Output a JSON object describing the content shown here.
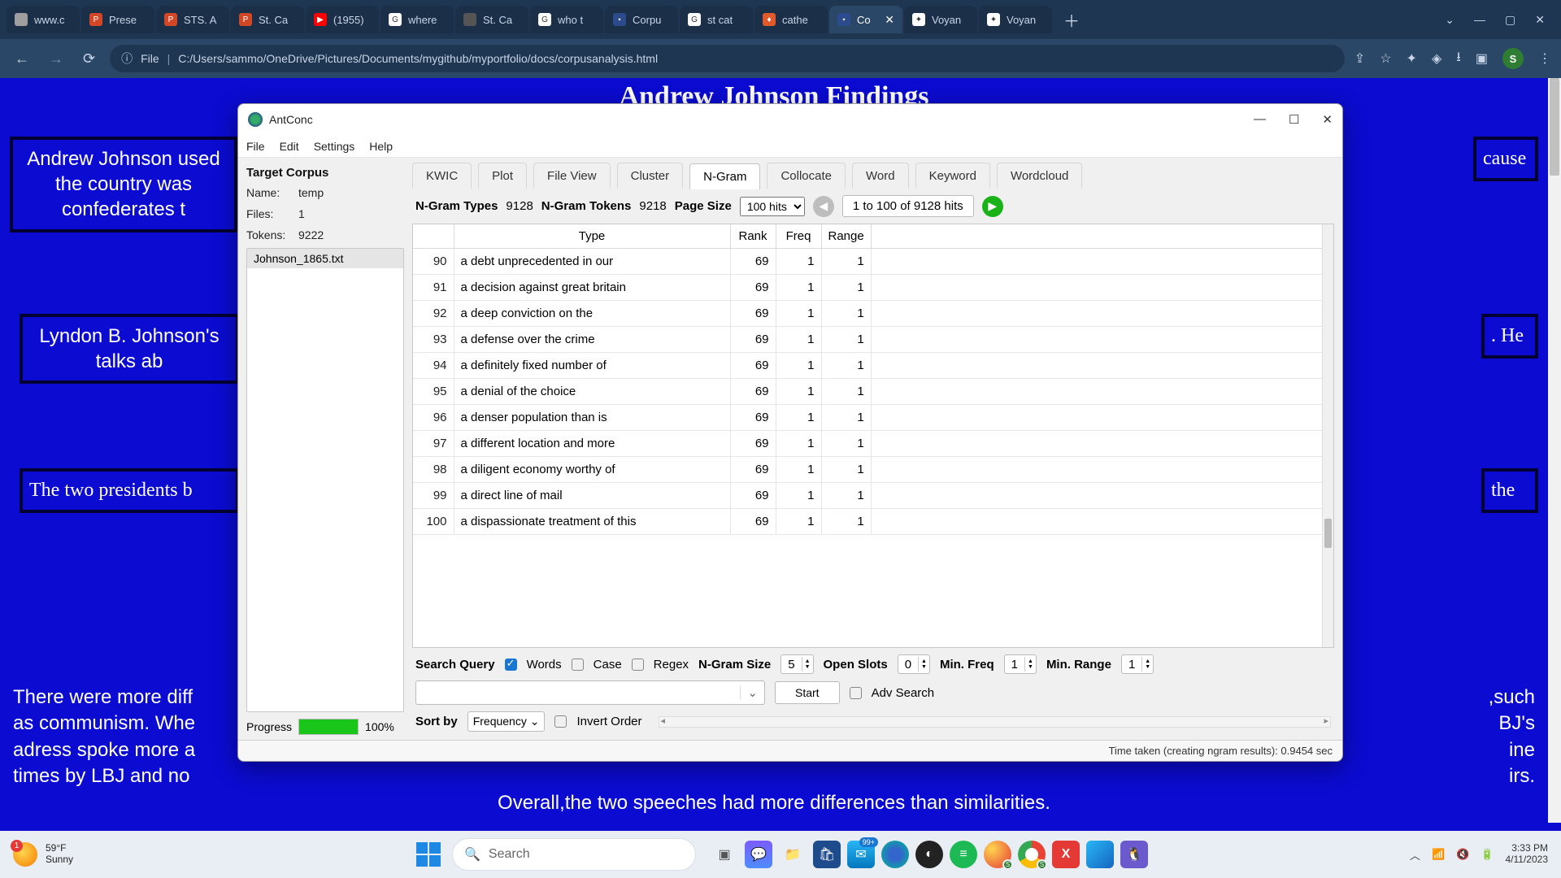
{
  "browser": {
    "tabs": [
      {
        "label": "www.c",
        "fav_bg": "#9e9e9e"
      },
      {
        "label": "Prese",
        "fav_bg": "#d24726",
        "fav_txt": "P"
      },
      {
        "label": "STS. A",
        "fav_bg": "#d24726",
        "fav_txt": "P"
      },
      {
        "label": "St. Ca",
        "fav_bg": "#d24726",
        "fav_txt": "P"
      },
      {
        "label": "(1955)",
        "fav_bg": "#ff0000",
        "fav_txt": "▶"
      },
      {
        "label": "where",
        "fav_bg": "#ffffff",
        "fav_txt": "G"
      },
      {
        "label": "St. Ca",
        "fav_bg": "#555555"
      },
      {
        "label": "who t",
        "fav_bg": "#ffffff",
        "fav_txt": "G"
      },
      {
        "label": "Corpu",
        "fav_bg": "#2b4b8c",
        "fav_txt": "⋆"
      },
      {
        "label": "st cat",
        "fav_bg": "#ffffff",
        "fav_txt": "G"
      },
      {
        "label": "cathe",
        "fav_bg": "#e05a2b",
        "fav_txt": "♦"
      },
      {
        "label": "Co",
        "fav_bg": "#2b4b8c",
        "fav_txt": "⋆",
        "active": true
      },
      {
        "label": "Voyan",
        "fav_bg": "#ffffff",
        "fav_txt": "✦"
      },
      {
        "label": "Voyan",
        "fav_bg": "#ffffff",
        "fav_txt": "✦"
      }
    ],
    "url_prefix": "File",
    "url_path": "C:/Users/sammo/OneDrive/Pictures/Documents/mygithub/myportfolio/docs/corpusanalysis.html",
    "avatar_letter": "S"
  },
  "page": {
    "heading": "Andrew Johnson Findings",
    "box1_a": "Andrew Johnson used",
    "box1_b": "the country was",
    "box1_c": "confederates t",
    "box1_right": "cause",
    "box2_a": "Lyndon B. Johnson's",
    "box2_b": "talks ab",
    "box2_right": ". He",
    "box3_a": "The two presidents b",
    "box3_right": " the",
    "box4_a": "There were more diff",
    "box4_b": "as communism. Whe",
    "box4_c": "adress spoke more a",
    "box4_d": "times by LBJ and no",
    "box4_r1": ",such",
    "box4_r2": "BJ's",
    "box4_r3": "ine",
    "box4_r4": "irs.",
    "bottom_line": "Overall,the two speeches had more differences than similarities."
  },
  "antconc": {
    "title": "AntConc",
    "menus": [
      "File",
      "Edit",
      "Settings",
      "Help"
    ],
    "left": {
      "heading": "Target Corpus",
      "name_label": "Name:",
      "name_value": "temp",
      "files_label": "Files:",
      "files_value": "1",
      "tokens_label": "Tokens:",
      "tokens_value": "9222",
      "file_item": "Johnson_1865.txt",
      "progress_label": "Progress",
      "progress_pct": "100%"
    },
    "tabs": [
      "KWIC",
      "Plot",
      "File View",
      "Cluster",
      "N-Gram",
      "Collocate",
      "Word",
      "Keyword",
      "Wordcloud"
    ],
    "active_tab": "N-Gram",
    "stats": {
      "types_label": "N-Gram Types",
      "types_value": "9128",
      "tokens_label": "N-Gram Tokens",
      "tokens_value": "9218",
      "pagesize_label": "Page Size",
      "pagesize_value": "100 hits",
      "range_text": "1 to 100 of 9128 hits"
    },
    "table": {
      "headers": {
        "type": "Type",
        "rank": "Rank",
        "freq": "Freq",
        "range": "Range"
      },
      "rows": [
        {
          "idx": "90",
          "type": "a debt unprecedented in our",
          "rank": "69",
          "freq": "1",
          "range": "1"
        },
        {
          "idx": "91",
          "type": "a decision against great britain",
          "rank": "69",
          "freq": "1",
          "range": "1"
        },
        {
          "idx": "92",
          "type": "a deep conviction on the",
          "rank": "69",
          "freq": "1",
          "range": "1"
        },
        {
          "idx": "93",
          "type": "a defense over the crime",
          "rank": "69",
          "freq": "1",
          "range": "1"
        },
        {
          "idx": "94",
          "type": "a definitely fixed number of",
          "rank": "69",
          "freq": "1",
          "range": "1"
        },
        {
          "idx": "95",
          "type": "a denial of the choice",
          "rank": "69",
          "freq": "1",
          "range": "1"
        },
        {
          "idx": "96",
          "type": "a denser population than is",
          "rank": "69",
          "freq": "1",
          "range": "1"
        },
        {
          "idx": "97",
          "type": "a different location and more",
          "rank": "69",
          "freq": "1",
          "range": "1"
        },
        {
          "idx": "98",
          "type": "a diligent economy worthy of",
          "rank": "69",
          "freq": "1",
          "range": "1"
        },
        {
          "idx": "99",
          "type": "a direct line of mail",
          "rank": "69",
          "freq": "1",
          "range": "1"
        },
        {
          "idx": "100",
          "type": "a dispassionate treatment of this",
          "rank": "69",
          "freq": "1",
          "range": "1"
        }
      ]
    },
    "query": {
      "label": "Search Query",
      "words": "Words",
      "case": "Case",
      "regex": "Regex",
      "size_label": "N-Gram Size",
      "size_value": "5",
      "slots_label": "Open Slots",
      "slots_value": "0",
      "minfreq_label": "Min. Freq",
      "minfreq_value": "1",
      "minrange_label": "Min. Range",
      "minrange_value": "1",
      "start": "Start",
      "adv": "Adv Search",
      "sort_label": "Sort by",
      "sort_value": "Frequency",
      "invert": "Invert Order"
    },
    "status": "Time taken (creating ngram results):  0.9454 sec"
  },
  "taskbar": {
    "temp": "59°F",
    "cond": "Sunny",
    "badge": "1",
    "search_placeholder": "Search",
    "mail_badge": "99+",
    "time": "3:33 PM",
    "date": "4/11/2023"
  }
}
